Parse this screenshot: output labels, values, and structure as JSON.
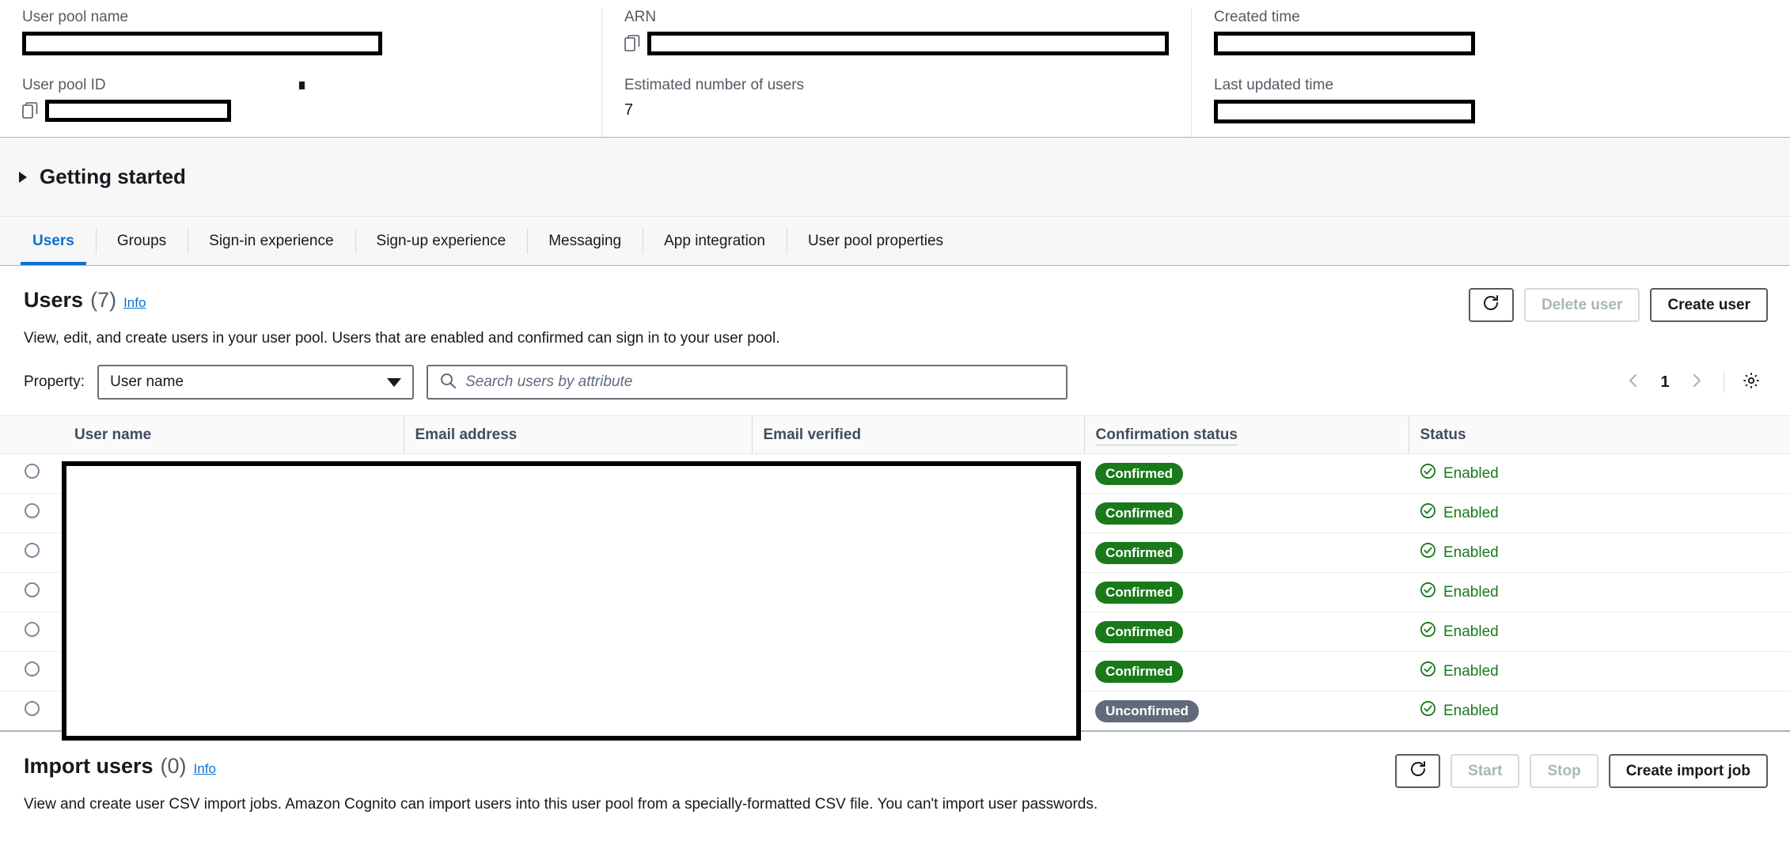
{
  "summary": {
    "fields": [
      {
        "label": "User pool name",
        "value": "",
        "redacted": true,
        "copyable": false
      },
      {
        "label": "User pool ID",
        "value": "",
        "redacted": true,
        "copyable": true
      },
      {
        "label": "ARN",
        "value": "",
        "redacted": true,
        "copyable": true
      },
      {
        "label": "Estimated number of users",
        "value": "7",
        "redacted": false,
        "copyable": false
      },
      {
        "label": "Created time",
        "value": "",
        "redacted": true,
        "copyable": false
      },
      {
        "label": "Last updated time",
        "value": "",
        "redacted": true,
        "copyable": false
      }
    ],
    "user_pool_name_label": "User pool name",
    "user_pool_id_label": "User pool ID",
    "arn_label": "ARN",
    "estimated_users_label": "Estimated number of users",
    "estimated_users_value": "7",
    "created_time_label": "Created time",
    "last_updated_time_label": "Last updated time"
  },
  "getting_started": {
    "title": "Getting started",
    "expanded": false,
    "caret_icon": "triangle-right-icon"
  },
  "tabs": [
    {
      "label": "Users",
      "active": true
    },
    {
      "label": "Groups",
      "active": false
    },
    {
      "label": "Sign-in experience",
      "active": false
    },
    {
      "label": "Sign-up experience",
      "active": false
    },
    {
      "label": "Messaging",
      "active": false
    },
    {
      "label": "App integration",
      "active": false
    },
    {
      "label": "User pool properties",
      "active": false
    }
  ],
  "users_section": {
    "title": "Users",
    "count": "(7)",
    "info_label": "Info",
    "description": "View, edit, and create users in your user pool. Users that are enabled and confirmed can sign in to your user pool.",
    "refresh_icon": "refresh-icon",
    "delete_button": "Delete user",
    "delete_disabled": true,
    "create_button": "Create user",
    "create_disabled": false,
    "property_label": "Property:",
    "property_value": "User name",
    "property_options": [
      "User name"
    ],
    "search_placeholder": "Search users by attribute",
    "search_value": "",
    "search_icon": "search-icon",
    "pagination": {
      "prev_icon": "chevron-left-icon",
      "next_icon": "chevron-right-icon",
      "current_page": "1"
    },
    "settings_icon": "gear-icon",
    "columns": [
      "User name",
      "Email address",
      "Email verified",
      "Confirmation status",
      "Status"
    ],
    "rows": [
      {
        "user_name": "",
        "email_address": "",
        "email_verified": "",
        "confirmation_status": "Confirmed",
        "status": "Enabled",
        "status_icon": "check-circle-icon",
        "selected": false
      },
      {
        "user_name": "",
        "email_address": "",
        "email_verified": "",
        "confirmation_status": "Confirmed",
        "status": "Enabled",
        "status_icon": "check-circle-icon",
        "selected": false
      },
      {
        "user_name": "",
        "email_address": "",
        "email_verified": "",
        "confirmation_status": "Confirmed",
        "status": "Enabled",
        "status_icon": "check-circle-icon",
        "selected": false
      },
      {
        "user_name": "",
        "email_address": "",
        "email_verified": "",
        "confirmation_status": "Confirmed",
        "status": "Enabled",
        "status_icon": "check-circle-icon",
        "selected": false
      },
      {
        "user_name": "",
        "email_address": "",
        "email_verified": "",
        "confirmation_status": "Confirmed",
        "status": "Enabled",
        "status_icon": "check-circle-icon",
        "selected": false
      },
      {
        "user_name": "",
        "email_address": "",
        "email_verified": "",
        "confirmation_status": "Confirmed",
        "status": "Enabled",
        "status_icon": "check-circle-icon",
        "selected": false
      },
      {
        "user_name": "",
        "email_address": "",
        "email_verified": "",
        "confirmation_status": "Unconfirmed",
        "status": "Enabled",
        "status_icon": "check-circle-icon",
        "selected": false
      }
    ]
  },
  "import_section": {
    "title": "Import users",
    "count": "(0)",
    "info_label": "Info",
    "description": "View and create user CSV import jobs. Amazon Cognito can import users into this user pool from a specially-formatted CSV file. You can't import user passwords.",
    "refresh_icon": "refresh-icon",
    "start_button": "Start",
    "start_disabled": true,
    "stop_button": "Stop",
    "stop_disabled": true,
    "create_import_button": "Create import job",
    "create_import_disabled": false
  },
  "colors": {
    "accent_blue": "#0972d3",
    "confirmed_green": "#1a7a1a",
    "unconfirmed_grey": "#5f6b7a",
    "text_dark": "#16191f",
    "text_muted": "#545b64",
    "panel_bg": "#f7f7f8",
    "border": "#aab2bd"
  }
}
